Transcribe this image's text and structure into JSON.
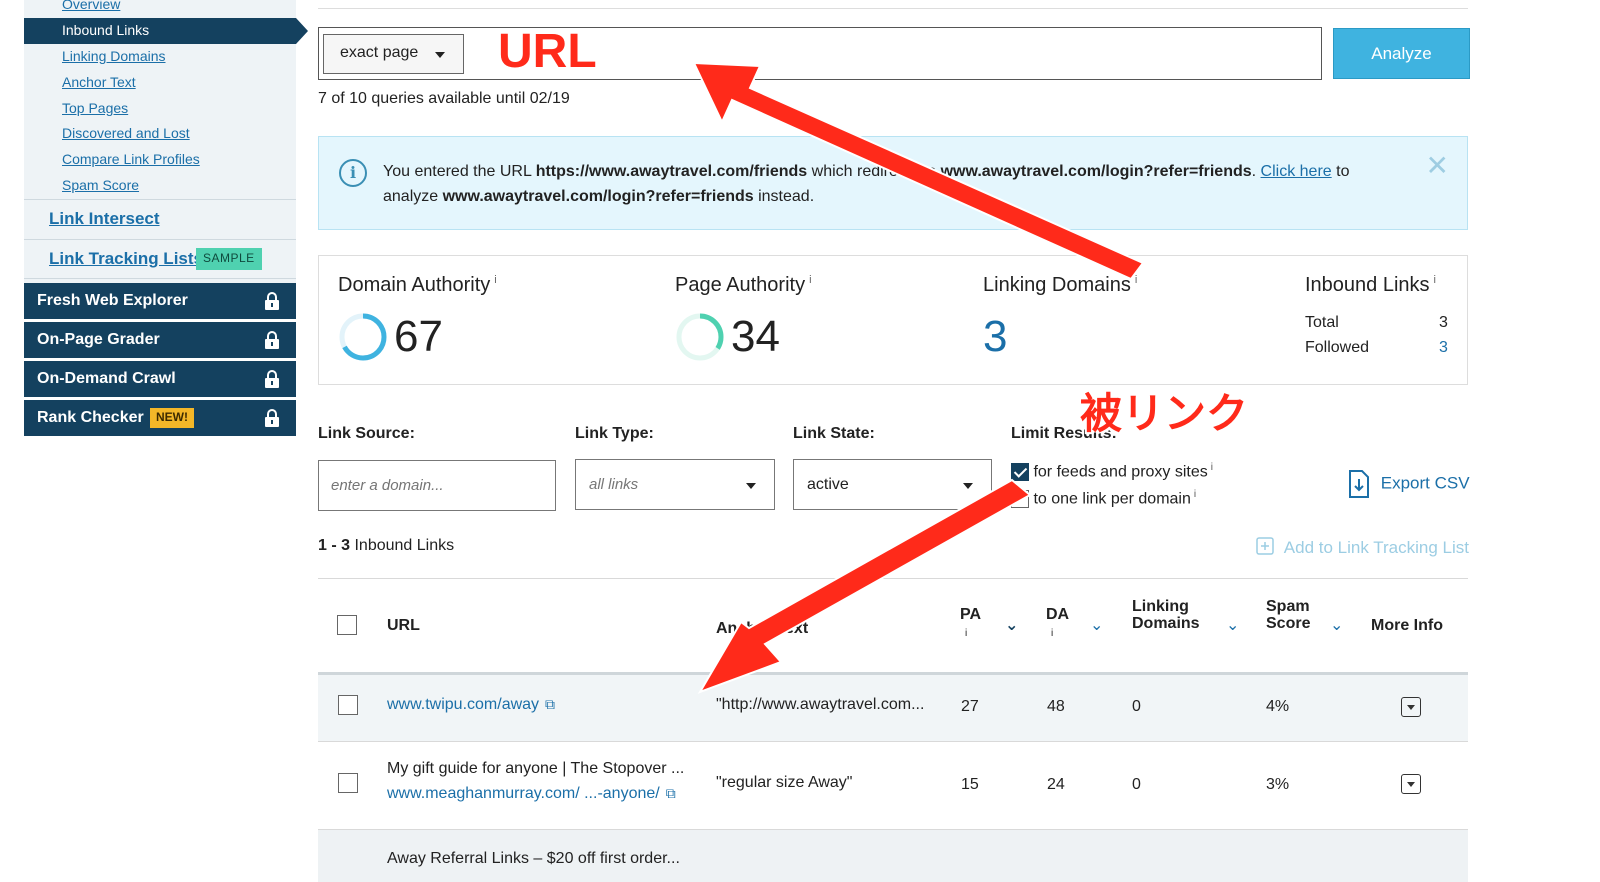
{
  "sidebar": {
    "sub_items": [
      "Overview",
      "Inbound Links",
      "Linking Domains",
      "Anchor Text",
      "Top Pages",
      "Discovered and Lost",
      "Compare Link Profiles",
      "Spam Score"
    ],
    "link_intersect": "Link Intersect",
    "link_tracking": "Link Tracking Lists",
    "sample_badge": "SAMPLE",
    "tools": [
      "Fresh Web Explorer",
      "On-Page Grader",
      "On-Demand Crawl",
      "Rank Checker"
    ],
    "new_badge": "NEW!"
  },
  "search": {
    "url_type": "exact page",
    "url_value": "",
    "analyze_label": "Analyze",
    "quota": "7 of 10 queries available until 02/19"
  },
  "banner": {
    "part1": "You entered the URL ",
    "entered_url": "https://www.awaytravel.com/friends",
    "part2": " which redirects to ",
    "redirect_url": "www.awaytravel.com/login?refer=friends",
    "part3": ". ",
    "click_here": "Click here",
    "part4": " to analyze ",
    "analyze_url": "www.awaytravel.com/login?refer=friends",
    "part5": " instead."
  },
  "metrics": {
    "domain_authority": {
      "label": "Domain Authority",
      "value": "67"
    },
    "page_authority": {
      "label": "Page Authority",
      "value": "34"
    },
    "linking_domains": {
      "label": "Linking Domains",
      "value": "3"
    },
    "inbound_links": {
      "label": "Inbound Links",
      "total_label": "Total",
      "total": "3",
      "followed_label": "Followed",
      "followed": "3"
    }
  },
  "filters": {
    "link_source_label": "Link Source:",
    "link_source_placeholder": "enter a domain...",
    "link_type_label": "Link Type:",
    "link_type_value": "all links",
    "link_state_label": "Link State:",
    "link_state_value": "active",
    "limit_label": "Limit Results:",
    "limit_opt1": "for feeds and proxy sites",
    "limit_opt2": "to one link per domain",
    "export_csv": "Export CSV",
    "add_to_tracking": "Add to Link Tracking List"
  },
  "results": {
    "range": "1 - 3",
    "label": "Inbound Links"
  },
  "table": {
    "headers": {
      "url": "URL",
      "anchor": "Anchor Text",
      "pa": "PA",
      "da": "DA",
      "ld1": "Linking",
      "ld2": "Domains",
      "spam1": "Spam",
      "spam2": "Score",
      "more": "More Info"
    },
    "rows": [
      {
        "title": "",
        "url": "www.twipu.com/away",
        "anchor": "\"http://www.awaytravel.com...",
        "pa": "27",
        "da": "48",
        "ld": "0",
        "spam": "4%"
      },
      {
        "title": "My gift guide for anyone | The Stopover ...",
        "url": "www.meaghanmurray.com/ ...-anyone/",
        "anchor": "\"regular size Away\"",
        "pa": "15",
        "da": "24",
        "ld": "0",
        "spam": "3%"
      },
      {
        "title": "Away Referral Links – $20 off first order..."
      }
    ]
  },
  "annotations": {
    "url_label": "URL",
    "backlink_label": "被リンク"
  },
  "colors": {
    "nav_dark": "#14415f",
    "link": "#1b6fa8",
    "analyze": "#3fb3e0",
    "banner_bg": "#e4f6fd",
    "annotation": "#ff2a1a",
    "sample": "#4fd1b0",
    "new": "#f4b728"
  }
}
